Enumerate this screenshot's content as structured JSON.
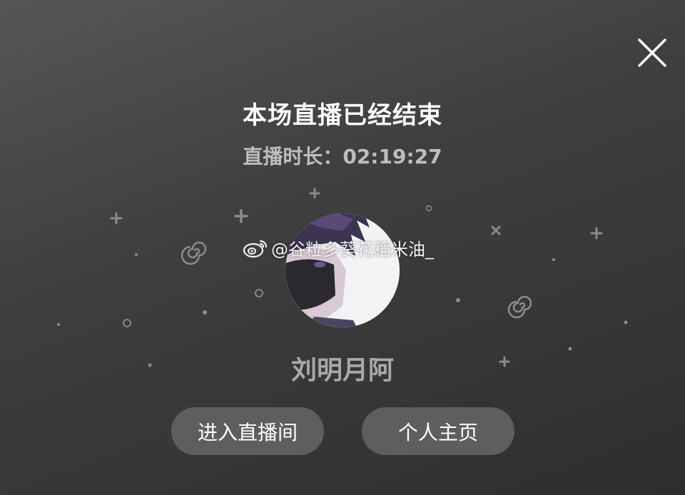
{
  "header": {
    "close_icon": "close-icon"
  },
  "live_end": {
    "title": "本场直播已经结束",
    "duration": "直播时长：02:19:27"
  },
  "streamer": {
    "avatar_icon": "avatar-image",
    "name": "刘明月阿"
  },
  "watermark": {
    "icon": "weibo-icon",
    "text": "@谷粒多葵花稻米油_"
  },
  "actions": {
    "enter_room_label": "进入直播间",
    "profile_label": "个人主页"
  },
  "colors": {
    "background": "#3f3f3f",
    "button_bg": "#5e5e5e",
    "title_text": "#ffffff",
    "name_text": "#a9a9a9"
  }
}
